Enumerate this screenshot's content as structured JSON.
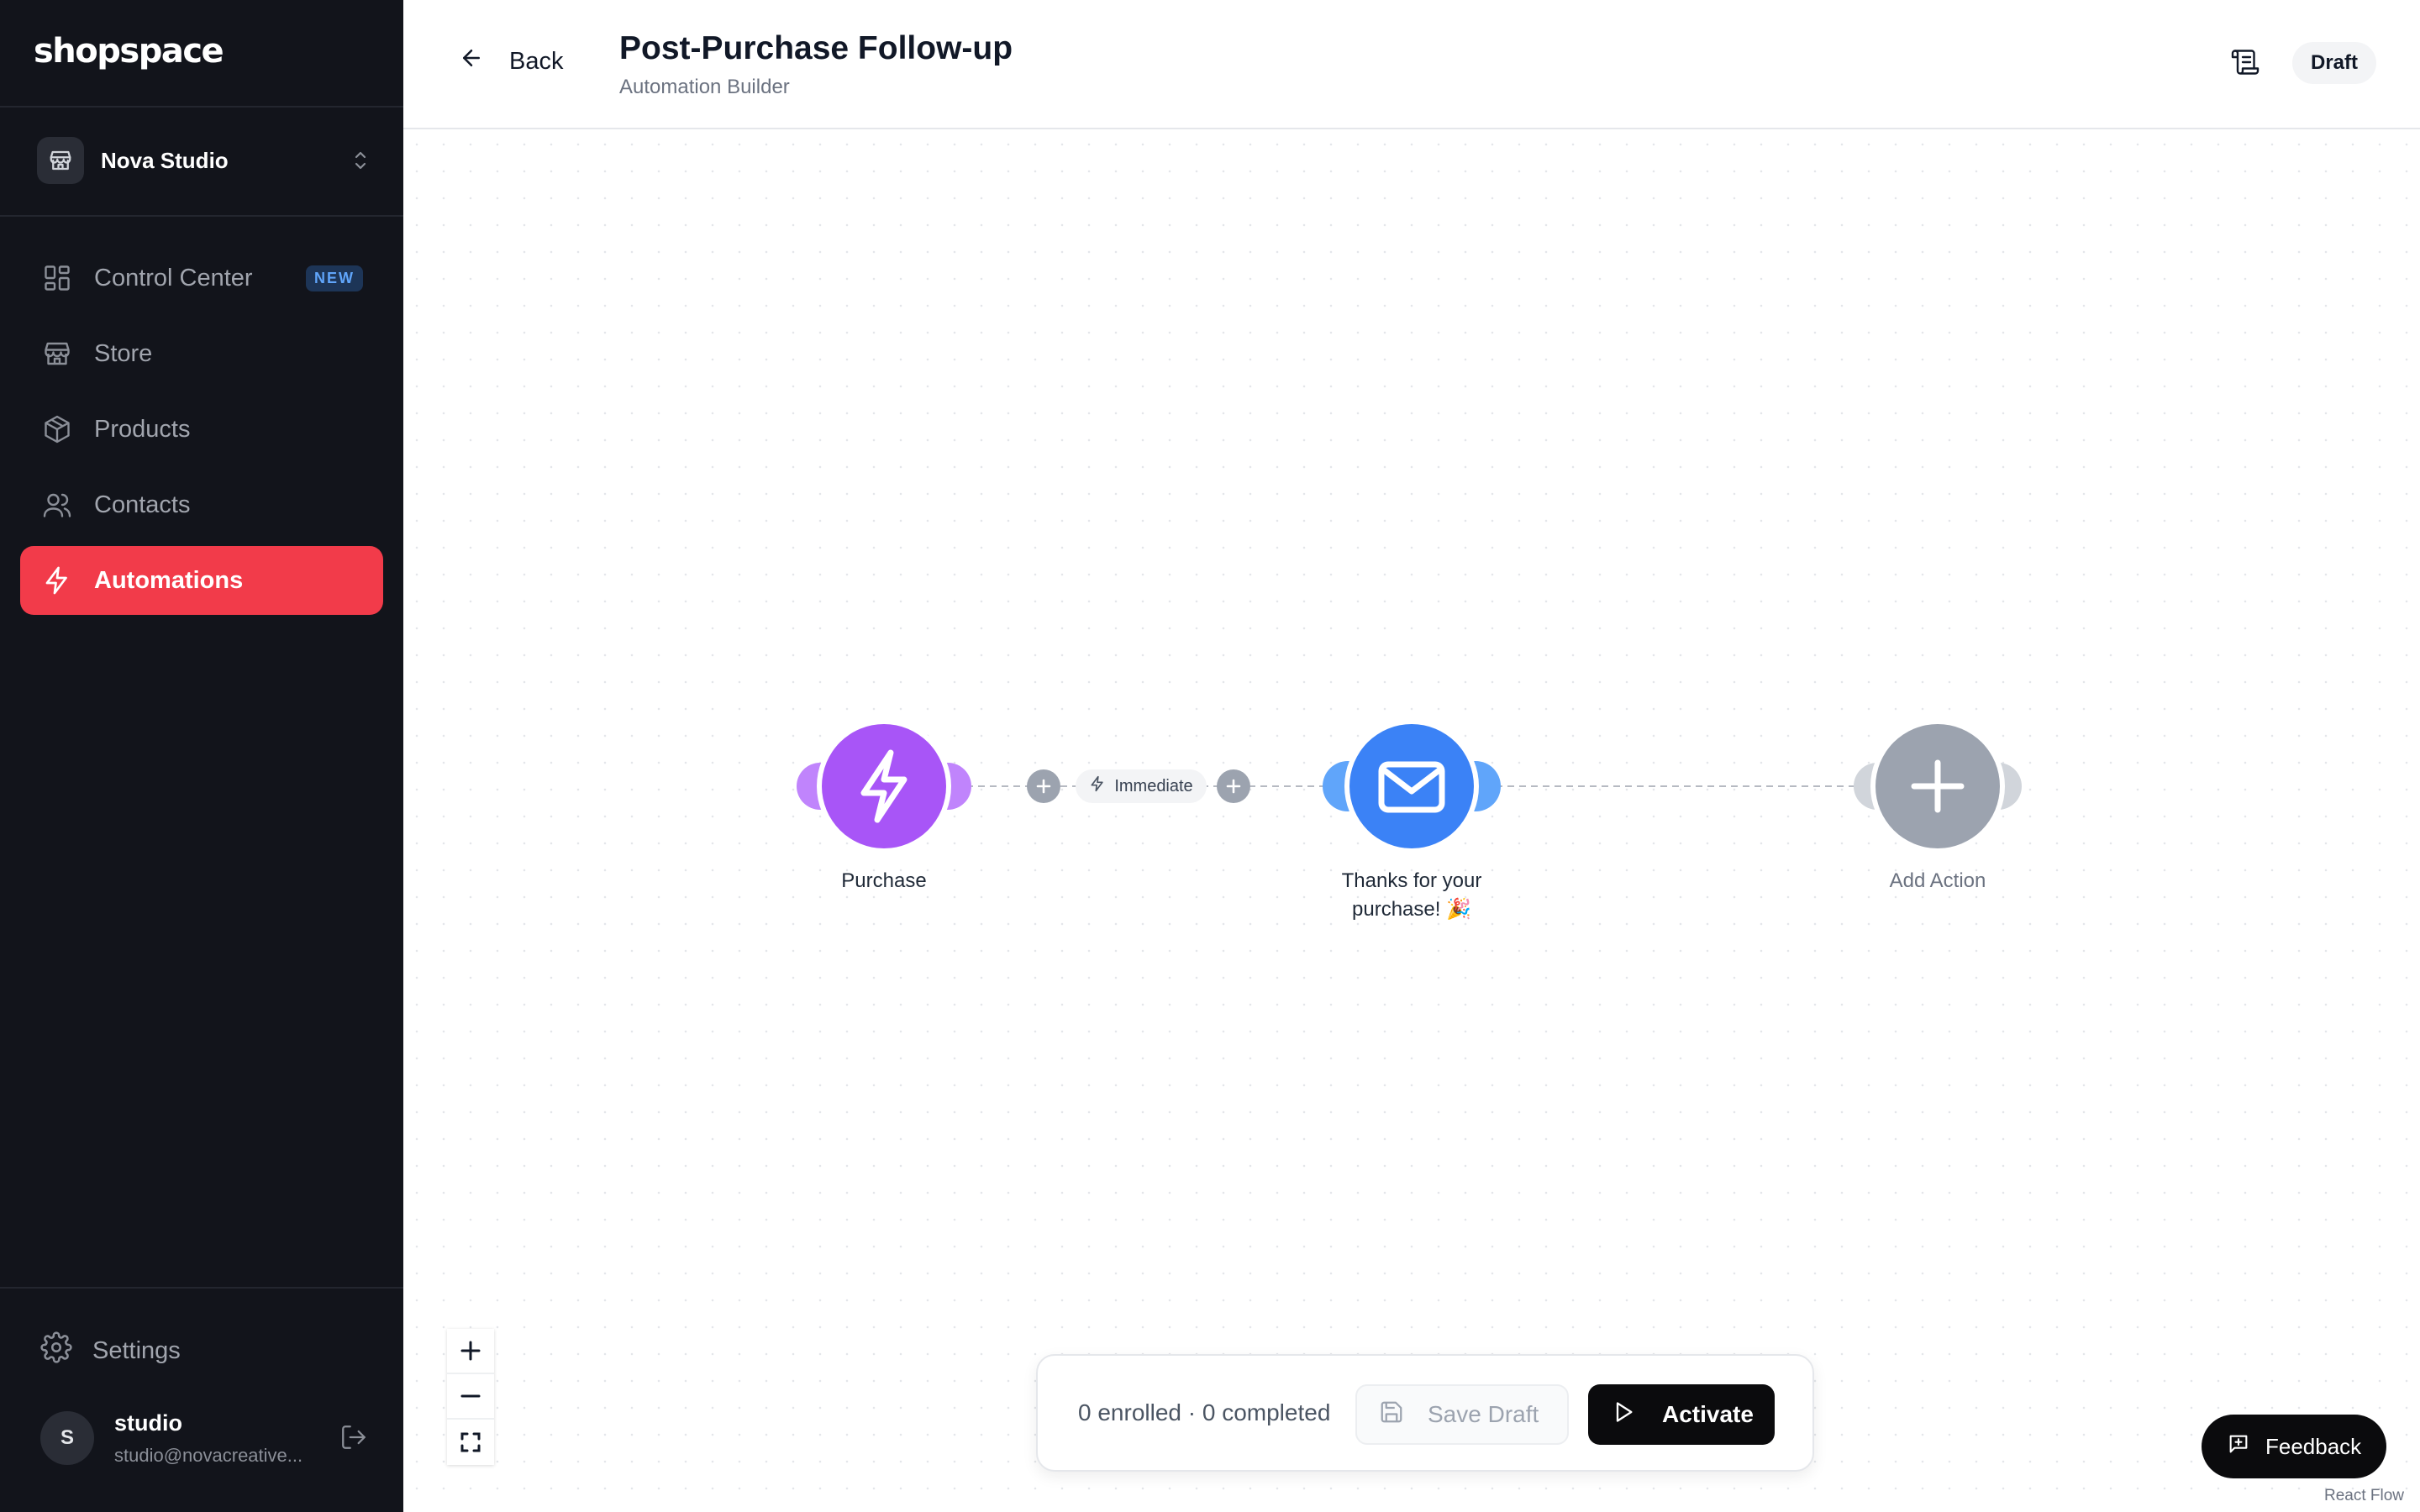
{
  "brand": "shopspace",
  "store": {
    "name": "Nova Studio"
  },
  "nav": [
    {
      "label": "Control Center",
      "badge": "NEW",
      "icon": "grid-icon"
    },
    {
      "label": "Store",
      "icon": "store-icon"
    },
    {
      "label": "Products",
      "icon": "box-icon"
    },
    {
      "label": "Contacts",
      "icon": "users-icon"
    },
    {
      "label": "Automations",
      "icon": "lightning-icon",
      "active": true
    }
  ],
  "settings": {
    "label": "Settings"
  },
  "user": {
    "initial": "S",
    "name": "studio",
    "email": "studio@novacreative..."
  },
  "header": {
    "back_label": "Back",
    "title": "Post-Purchase Follow-up",
    "subtitle": "Automation Builder",
    "status": "Draft"
  },
  "flow": {
    "trigger": {
      "label": "Purchase",
      "color": "#a855f7"
    },
    "delay": {
      "label": "Immediate"
    },
    "email": {
      "label_line1": "Thanks for your",
      "label_line2": "purchase! 🎉",
      "color": "#3b82f6"
    },
    "add": {
      "label": "Add Action",
      "color": "#9ca3af"
    }
  },
  "bottom_bar": {
    "stats": "0 enrolled · 0 completed",
    "save_label": "Save Draft",
    "activate_label": "Activate"
  },
  "feedback_label": "Feedback",
  "attribution": "React Flow",
  "colors": {
    "accent": "#f23b4a",
    "sidebar_bg": "#12141b"
  }
}
